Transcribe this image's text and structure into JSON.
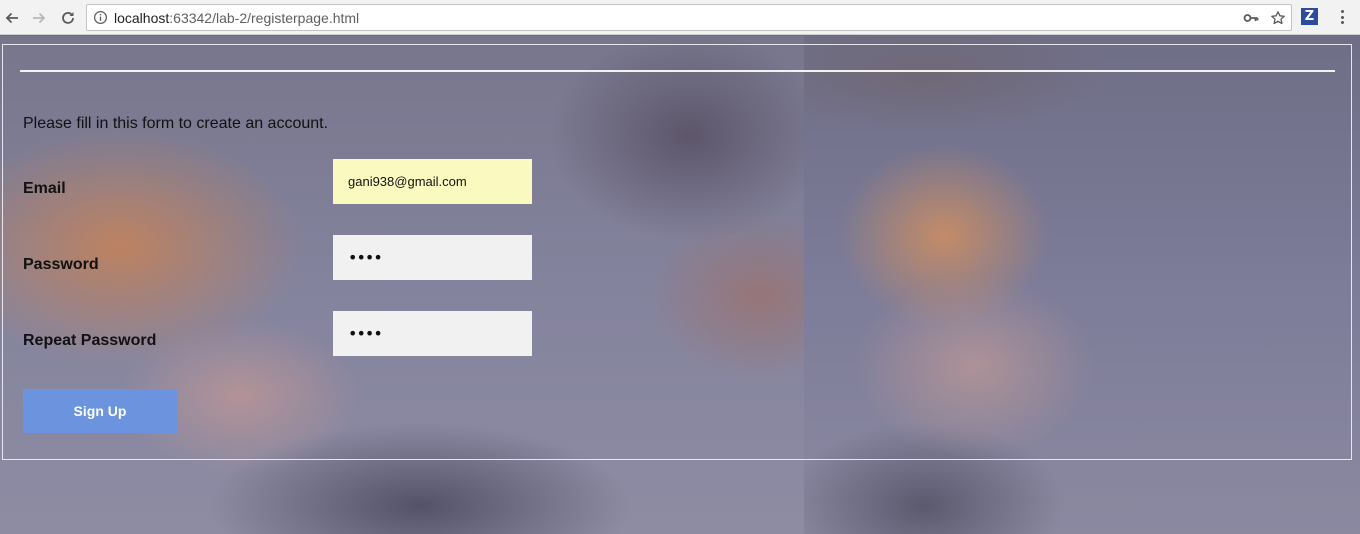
{
  "browser": {
    "url_host": "localhost",
    "url_rest": ":63342/lab-2/registerpage.html",
    "extension_label": "Z",
    "icons": [
      "back-icon",
      "forward-icon",
      "reload-icon",
      "info-icon",
      "key-icon",
      "star-icon",
      "z-extension-icon",
      "menu-icon"
    ]
  },
  "form": {
    "intro": "Please fill in this form to create an account.",
    "email_label": "Email",
    "email_value": "gani938@gmail.com",
    "password_label": "Password",
    "password_value": "••••",
    "repeat_label": "Repeat Password",
    "repeat_value": "••••",
    "signup_label": "Sign Up"
  },
  "colors": {
    "button": "#6b93de",
    "autofill": "#fafac0",
    "field": "#f1f1f1"
  }
}
